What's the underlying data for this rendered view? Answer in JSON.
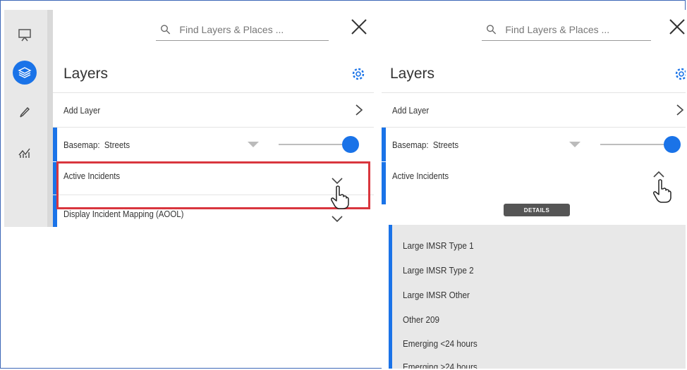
{
  "search": {
    "placeholder": "Find Layers & Places ..."
  },
  "rail": {
    "items": [
      {
        "name": "presentation",
        "icon": "presentation-icon"
      },
      {
        "name": "layers",
        "icon": "layers-icon",
        "active": true
      },
      {
        "name": "edit",
        "icon": "pencil-icon"
      },
      {
        "name": "analytics",
        "icon": "chart-icon"
      }
    ]
  },
  "left_panel": {
    "title": "Layers",
    "rows": {
      "add_layer": "Add Layer",
      "basemap_label": "Basemap:",
      "basemap_value": "Streets",
      "active_incidents": "Active Incidents",
      "display_incident": "Display Incident Mapping (AOOL)"
    },
    "basemap_opacity": 1.0
  },
  "right_panel": {
    "title": "Layers",
    "rows": {
      "add_layer": "Add Layer",
      "basemap_label": "Basemap:",
      "basemap_value": "Streets",
      "active_incidents": "Active Incidents"
    },
    "basemap_opacity": 1.0,
    "details_label": "DETAILS",
    "sublayers": [
      "Large IMSR Type 1",
      "Large IMSR Type 2",
      "Large IMSR Other",
      "Other 209",
      "Emerging <24 hours",
      "Emerging >24 hours"
    ]
  },
  "colors": {
    "accent": "#1a73e8",
    "highlight": "#d9363e",
    "rail": "#e8e8e8"
  }
}
